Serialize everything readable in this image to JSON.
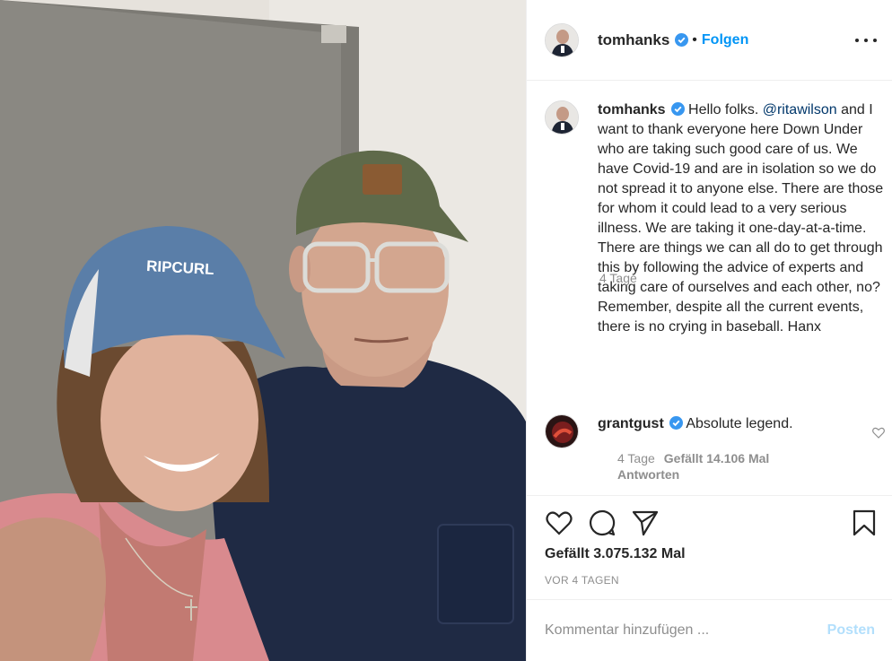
{
  "post": {
    "author": "tomhanks",
    "follow_label": "Folgen",
    "dot": "•",
    "cap_text": "RIPCURL"
  },
  "caption": {
    "username": "tomhanks",
    "text_before": " Hello folks. ",
    "mention": "@ritawilson",
    "text_after": " and I want to thank everyone here Down Under who are taking such good care of us. We have Covid-19 and are in isolation so we do not spread it to anyone else. There are those for whom it could lead to a very serious illness. We are taking it one-day-at-a-time. There are things we can all do to get through this by following the advice of experts and taking care of ourselves and each other, no? Remember, despite all the current events, there is no crying in baseball. Hanx",
    "time": "4 Tage"
  },
  "comment": {
    "username": "grantgust",
    "text": " Absolute legend.",
    "time": "4 Tage",
    "likes": "Gefällt 14.106 Mal",
    "reply": "Antworten"
  },
  "actions": {
    "likes_total": "Gefällt 3.075.132 Mal",
    "time_ago": "VOR 4 TAGEN"
  },
  "add_comment": {
    "placeholder": "Kommentar hinzufügen ...",
    "post_label": "Posten"
  },
  "colors": {
    "accent": "#0095f6",
    "verified": "#3897f0",
    "muted": "#8e8e8e",
    "post_disabled": "#b2dffc"
  }
}
